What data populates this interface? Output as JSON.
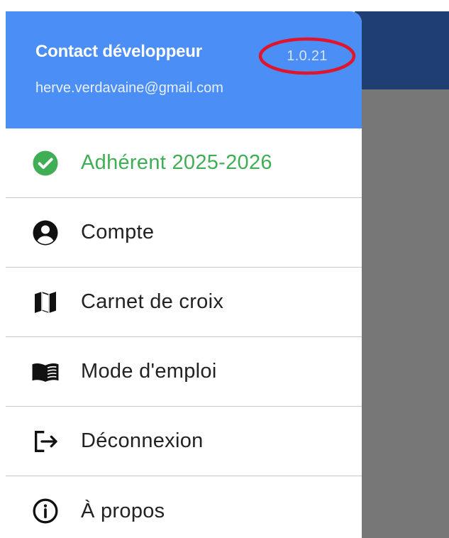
{
  "header": {
    "title": "Contact développeur",
    "email": "herve.verdavaine@gmail.com",
    "version": "1.0.21"
  },
  "menu": [
    {
      "label": "Adhérent 2025-2026",
      "icon": "check-circle-icon",
      "color": "#3fae55"
    },
    {
      "label": "Compte",
      "icon": "account-circle-icon"
    },
    {
      "label": "Carnet de croix",
      "icon": "map-icon"
    },
    {
      "label": "Mode d'emploi",
      "icon": "book-icon"
    },
    {
      "label": "Déconnexion",
      "icon": "logout-icon"
    },
    {
      "label": "À propos",
      "icon": "info-icon"
    }
  ],
  "colors": {
    "header_bg": "#4b8ef5",
    "app_bar": "#1f3e72",
    "scrim": "#777777",
    "annotation": "#e0142a"
  }
}
